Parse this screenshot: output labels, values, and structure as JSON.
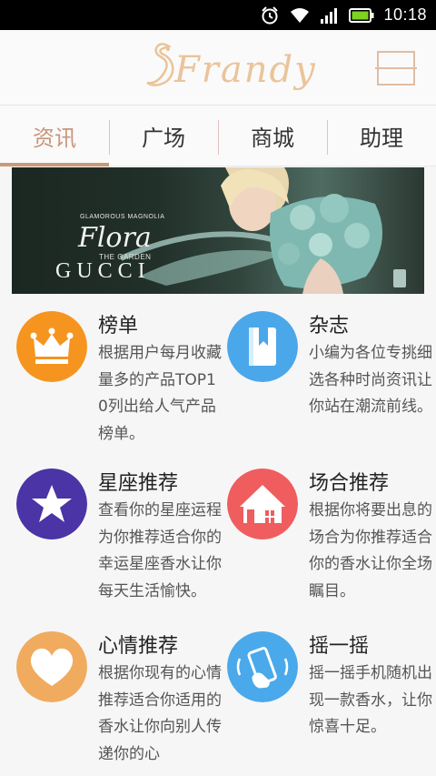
{
  "status_bar": {
    "time": "10:18"
  },
  "app": {
    "logo_text": "Frandy"
  },
  "tabs": [
    {
      "label": "资讯",
      "active": true
    },
    {
      "label": "广场",
      "active": false
    },
    {
      "label": "商城",
      "active": false
    },
    {
      "label": "助理",
      "active": false
    }
  ],
  "banner": {
    "small_text": "GLAMOROUS MAGNOLIA",
    "script_text": "Flora",
    "garden_text": "THE GARDEN",
    "brand_text": "GUCCI"
  },
  "features": [
    {
      "icon": "crown-icon",
      "color": "#f5951f",
      "title": "榜单",
      "desc": "根据用户每月收藏量多的产品TOP10列出给人气产品榜单。"
    },
    {
      "icon": "bookmark-book-icon",
      "color": "#4aa7ea",
      "title": "杂志",
      "desc": "小编为各位专挑细选各种时尚资讯让你站在潮流前线。"
    },
    {
      "icon": "star-icon",
      "color": "#4a34a6",
      "title": "星座推荐",
      "desc": "查看你的星座运程为你推荐适合你的幸运星座香水让你每天生活愉快。"
    },
    {
      "icon": "house-icon",
      "color": "#ef5d5f",
      "title": "场合推荐",
      "desc": "根据你将要出息的场合为你推荐适合你的香水让你全场瞩目。"
    },
    {
      "icon": "heart-icon",
      "color": "#f0ab5e",
      "title": "心情推荐",
      "desc": "根据你现有的心情推荐适合你适用的香水让你向别人传递你的心"
    },
    {
      "icon": "shake-phone-icon",
      "color": "#4aa9ea",
      "title": "摇一摇",
      "desc": "摇一摇手机随机出现一款香水，让你惊喜十足。"
    }
  ]
}
